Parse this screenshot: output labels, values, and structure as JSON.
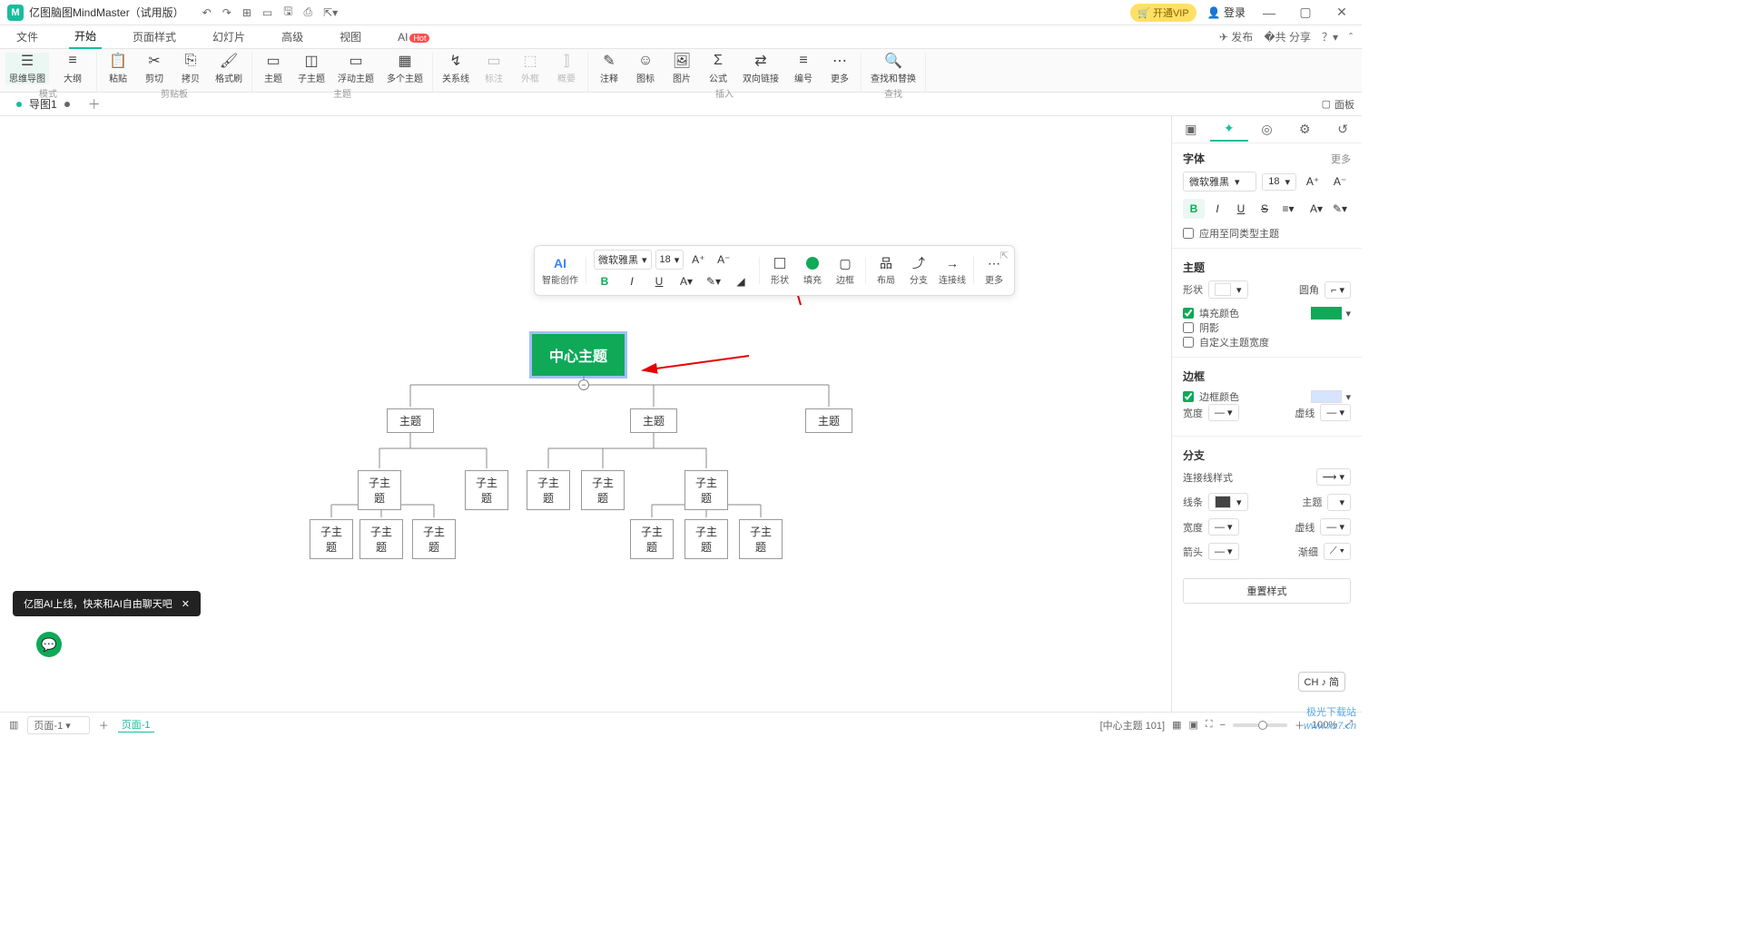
{
  "app": {
    "title": "亿图脑图MindMaster（试用版）"
  },
  "titlebar": {
    "vip": "开通VIP",
    "login": "登录"
  },
  "menu": {
    "tabs": [
      "文件",
      "开始",
      "页面样式",
      "幻灯片",
      "高级",
      "视图",
      "AI"
    ],
    "active": 1,
    "publish": "发布",
    "share": "分享"
  },
  "ribbon": {
    "mode": {
      "mindmap": "思维导图",
      "outline": "大纲",
      "label": "模式"
    },
    "clip": {
      "paste": "粘贴",
      "cut": "剪切",
      "copy": "拷贝",
      "fmt": "格式刷",
      "label": "剪贴板"
    },
    "topic": {
      "topic": "主题",
      "sub": "子主题",
      "float": "浮动主题",
      "multi": "多个主题",
      "label": "主题"
    },
    "rel": {
      "rel": "关系线",
      "callout": "标注",
      "boundary": "外框",
      "summary": "概要"
    },
    "insert": {
      "note": "注释",
      "icon": "图标",
      "img": "图片",
      "formula": "公式",
      "link": "双向链接",
      "number": "编号",
      "more": "更多",
      "label": "插入"
    },
    "find": {
      "find": "查找和替换",
      "label": "查找"
    }
  },
  "doctab": {
    "name": "导图1"
  },
  "panel_toggle": "面板",
  "mindmap": {
    "central": "中心主题",
    "topic": "主题",
    "sub": "子主题"
  },
  "float": {
    "ai": "AI",
    "ai_sub": "智能创作",
    "font": "微软雅黑",
    "size": "18",
    "shape": "形状",
    "fill": "填充",
    "border": "边框",
    "layout": "布局",
    "branch": "分支",
    "connector": "连接线",
    "more": "更多"
  },
  "rpanel": {
    "font_h": "字体",
    "more": "更多",
    "font": "微软雅黑",
    "size": "18",
    "apply": "应用至同类型主题",
    "theme_h": "主题",
    "shape": "形状",
    "corner": "圆角",
    "fill": "填充颜色",
    "shadow": "阴影",
    "custom": "自定义主题宽度",
    "border_h": "边框",
    "bcolor": "边框颜色",
    "bwidth": "宽度",
    "bdash": "虚线",
    "branch_h": "分支",
    "connstyle": "连接线样式",
    "linecolor": "线条",
    "themelbl": "主题",
    "lwidth": "宽度",
    "ldash": "虚线",
    "arrow": "箭头",
    "taper": "渐细",
    "reset": "重置样式"
  },
  "status": {
    "page": "页面-1",
    "pagelabel": "页面-1",
    "info": "[中心主题 101]",
    "zoom": "100%"
  },
  "toast": "亿图AI上线，快来和AI自由聊天吧",
  "ime": "CH ♪ 简",
  "watermark": "极光下载站",
  "watermark2": "www.xz7.cn"
}
